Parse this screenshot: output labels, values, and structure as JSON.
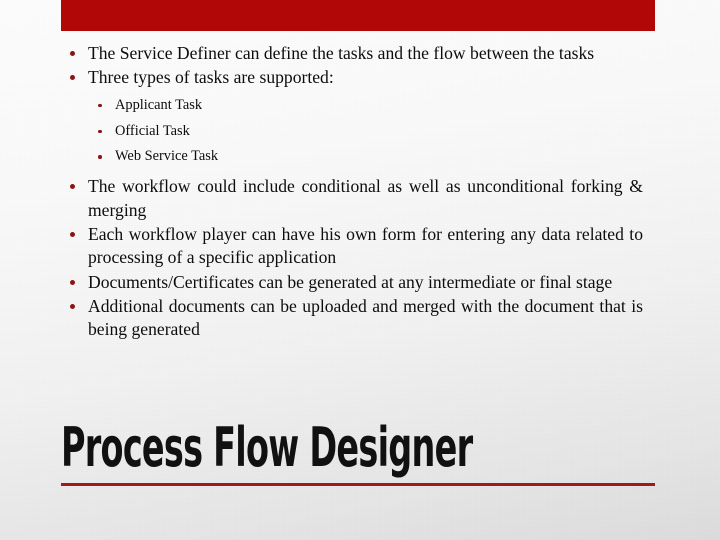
{
  "slide": {
    "accent_color": "#b20707",
    "bullet_color": "#8c1414",
    "rule_color": "#9e1b1b",
    "text_color": "#0d0d0d",
    "background_color": "#efefef",
    "title": "Process Flow Designer",
    "bullets": [
      {
        "text": "The Service Definer can define the tasks and the flow between the tasks",
        "justified": true
      },
      {
        "text": "Three types of tasks are supported:",
        "justified": false,
        "sub_bullets": [
          "Applicant Task",
          "Official Task",
          "Web Service Task"
        ]
      },
      {
        "text": "The workflow could include conditional as well as unconditional forking & merging",
        "justified": true
      },
      {
        "text": "Each workflow player can have his own form for entering any data related to processing of a specific application",
        "justified": true
      },
      {
        "text": "Documents/Certificates can be generated at any intermediate or final stage",
        "justified": true
      },
      {
        "text": "Additional documents can be uploaded and merged with the document that is being generated",
        "justified": true
      }
    ]
  }
}
